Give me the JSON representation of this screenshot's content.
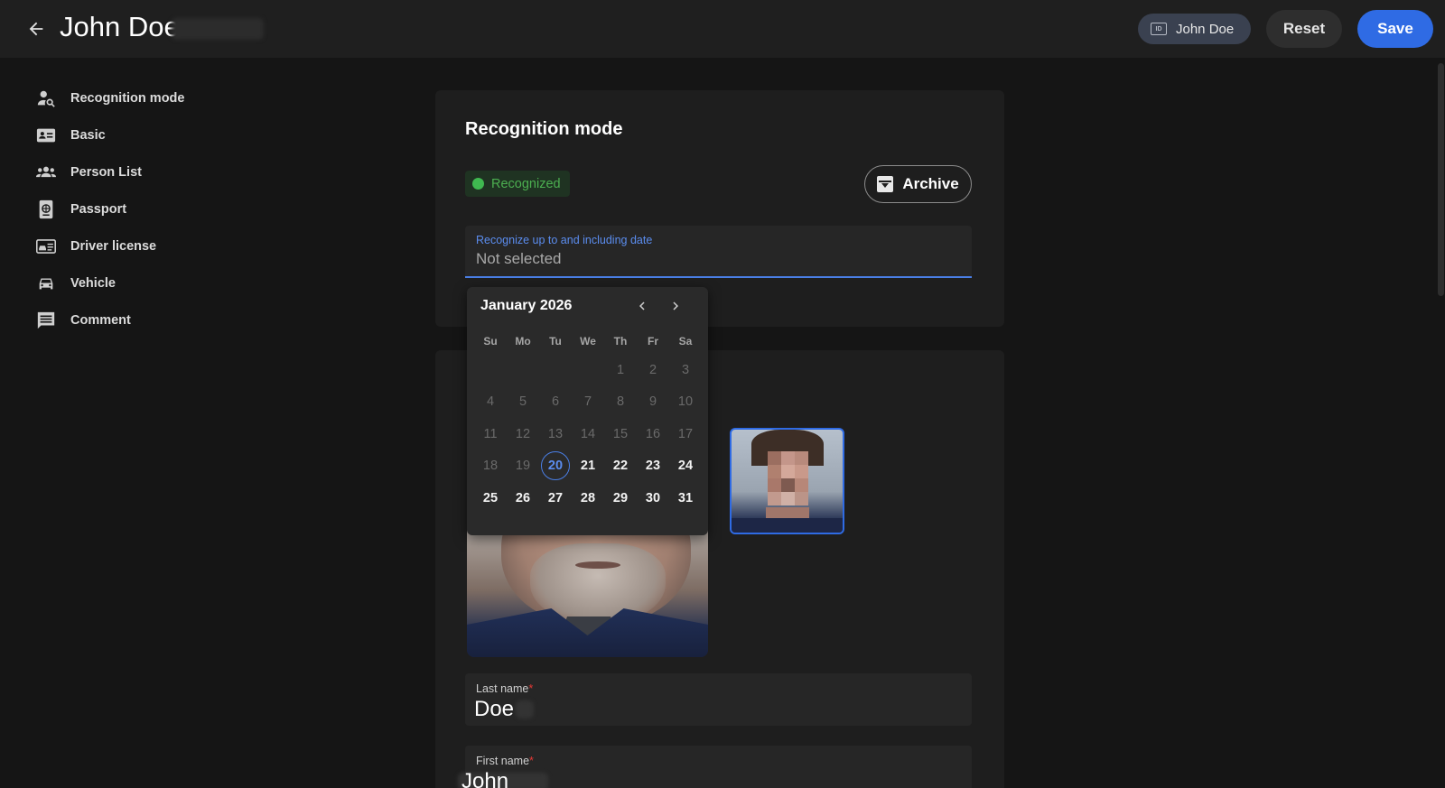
{
  "header": {
    "title": "John Doe",
    "chip_label": "John Doe",
    "reset_label": "Reset",
    "save_label": "Save"
  },
  "sidebar": {
    "items": [
      {
        "label": "Recognition mode",
        "icon": "person-search-icon"
      },
      {
        "label": "Basic",
        "icon": "id-card-icon"
      },
      {
        "label": "Person List",
        "icon": "group-icon"
      },
      {
        "label": "Passport",
        "icon": "passport-icon"
      },
      {
        "label": "Driver license",
        "icon": "driver-license-icon"
      },
      {
        "label": "Vehicle",
        "icon": "car-icon"
      },
      {
        "label": "Comment",
        "icon": "comment-icon"
      }
    ]
  },
  "recognition": {
    "section_title": "Recognition mode",
    "status_label": "Recognized",
    "archive_label": "Archive",
    "date_field": {
      "label": "Recognize up to and including date",
      "value": "Not selected"
    }
  },
  "calendar": {
    "month_label": "January 2026",
    "weekdays": [
      "Su",
      "Mo",
      "Tu",
      "We",
      "Th",
      "Fr",
      "Sa"
    ],
    "weeks": [
      [
        "",
        "",
        "",
        "",
        "1",
        "2",
        "3"
      ],
      [
        "4",
        "5",
        "6",
        "7",
        "8",
        "9",
        "10"
      ],
      [
        "11",
        "12",
        "13",
        "14",
        "15",
        "16",
        "17"
      ],
      [
        "18",
        "19",
        "20",
        "21",
        "22",
        "23",
        "24"
      ],
      [
        "25",
        "26",
        "27",
        "28",
        "29",
        "30",
        "31"
      ]
    ],
    "today": "20",
    "first_selectable_day": 20
  },
  "form": {
    "last_name": {
      "label": "Last name",
      "required_mark": "*",
      "value": "Doe"
    },
    "first_name": {
      "label": "First name",
      "required_mark": "*",
      "value": "John"
    }
  },
  "colors": {
    "accent": "#2f6be4",
    "status_green": "#3fb950",
    "background": "#151515",
    "card": "#1e1e1e"
  }
}
